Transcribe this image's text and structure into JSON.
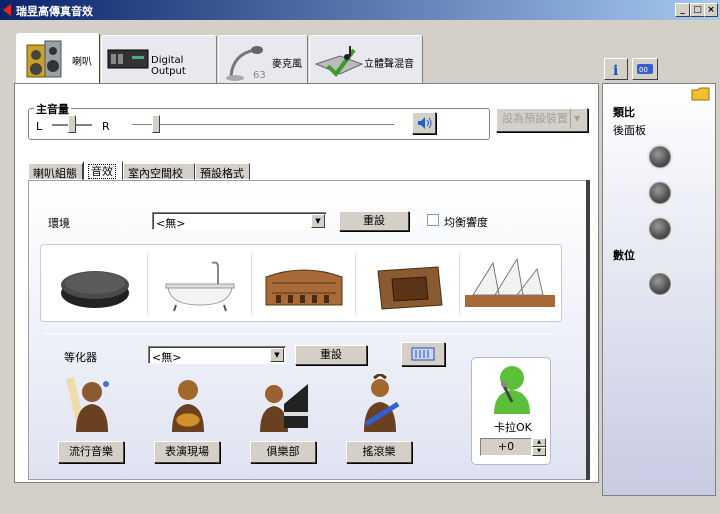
{
  "window": {
    "title": "瑞昱高傳真音效"
  },
  "tabs": [
    {
      "label": "喇叭"
    },
    {
      "label": "Digital Output"
    },
    {
      "label": "麥克風"
    },
    {
      "label": "立體聲混音"
    }
  ],
  "volume": {
    "label": "主音量",
    "left": "L",
    "right": "R",
    "level": 0.02,
    "balance": 0.5
  },
  "default_device_button": "設為預設裝置",
  "subtabs": [
    {
      "label": "喇叭組態"
    },
    {
      "label": "音效"
    },
    {
      "label": "室內空間校正"
    },
    {
      "label": "預設格式"
    }
  ],
  "environment": {
    "label": "環境",
    "value": "<無>",
    "reset": "重設",
    "loudness": "均衡響度"
  },
  "equalizer": {
    "label": "等化器",
    "value": "<無>",
    "reset": "重設"
  },
  "genres": [
    {
      "label": "流行音樂"
    },
    {
      "label": "表演現場"
    },
    {
      "label": "俱樂部"
    },
    {
      "label": "搖滾樂"
    }
  ],
  "karaoke": {
    "label": "卡拉OK",
    "value": "+0"
  },
  "right_panel": {
    "analog": "類比",
    "back_panel": "後面板",
    "digital": "數位"
  },
  "colors": {
    "accent": "#0a246a",
    "title_grad_end": "#a6caf0",
    "karaoke_green": "#5cbf3a"
  }
}
